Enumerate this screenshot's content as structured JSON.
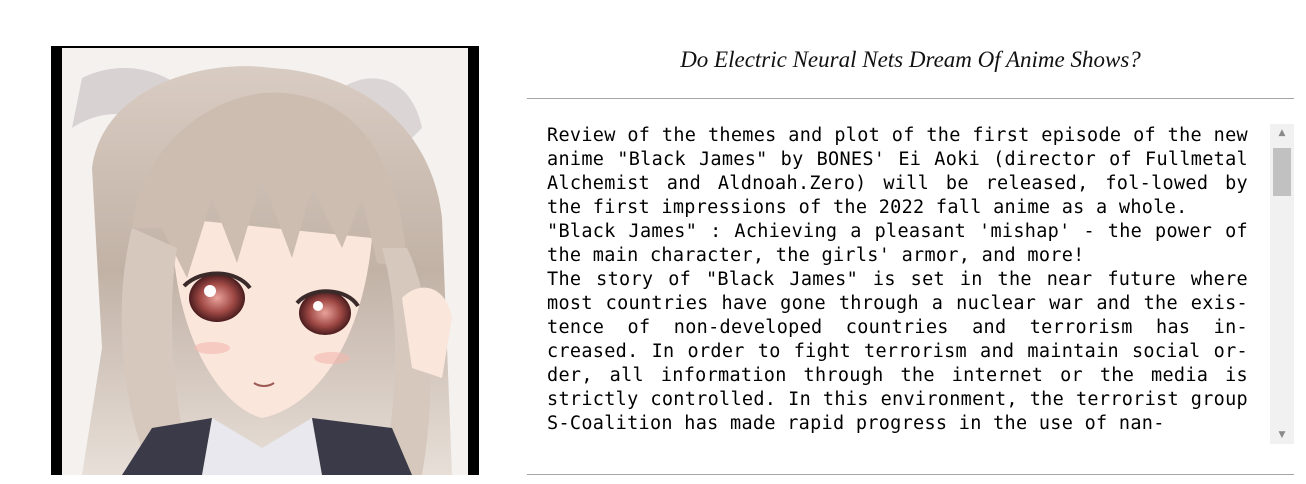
{
  "page": {
    "title": "Do Electric Neural Nets Dream Of Anime Shows?"
  },
  "image": {
    "icon": "anime-portrait-image"
  },
  "review": {
    "paragraphs": [
      "Review of the themes and plot of the first episode of the new anime \"Black James\" by BONES' Ei Aoki (director of Fullmetal Alchemist and Aldnoah.Zero) will be released, fol-lowed by the first impressions of the 2022 fall anime as a whole.",
      "\"Black James\" : Achieving a pleasant 'mishap' - the power of the main character, the girls' armor, and more!",
      "The story of \"Black James\" is set in the near future where most countries have gone through a nuclear war and the exis-tence of non-developed countries and terrorism has in-creased. In order to fight terrorism and maintain social or-der, all information through the internet or the media is strictly controlled. In this environment, the terrorist group S-Coalition has made rapid progress in the use of nan-"
    ]
  },
  "scrollbar": {
    "up_icon": "arrow-up-icon",
    "down_icon": "arrow-down-icon"
  },
  "colors": {
    "rule": "#a6a6a6",
    "scrollbar_track": "#f1f1f1",
    "scrollbar_thumb": "#c1c1c1"
  }
}
